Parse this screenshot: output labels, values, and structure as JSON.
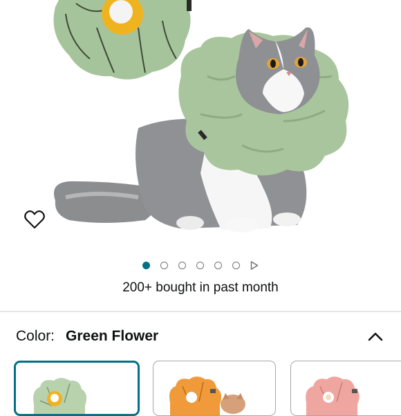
{
  "gallery": {
    "image_alt": "Cat wearing green flower recovery cone",
    "dot_count": 6,
    "active_dot": 0
  },
  "social_proof": {
    "bought_text": "200+ bought in past month"
  },
  "variation": {
    "label": "Color:",
    "selected_value": "Green Flower",
    "swatches": [
      {
        "name": "Green Flower",
        "color": "#b9d2ae",
        "center": "#f0b320",
        "selected": true
      },
      {
        "name": "Orange Flower",
        "color": "#f09a3a",
        "center": "#ffffff",
        "selected": false
      },
      {
        "name": "Pink Flower",
        "color": "#f0a6a0",
        "center": "#ffffff",
        "selected": false
      }
    ]
  },
  "colors": {
    "accent": "#007185",
    "text": "#0f1111",
    "divider": "#e3e6e6"
  }
}
